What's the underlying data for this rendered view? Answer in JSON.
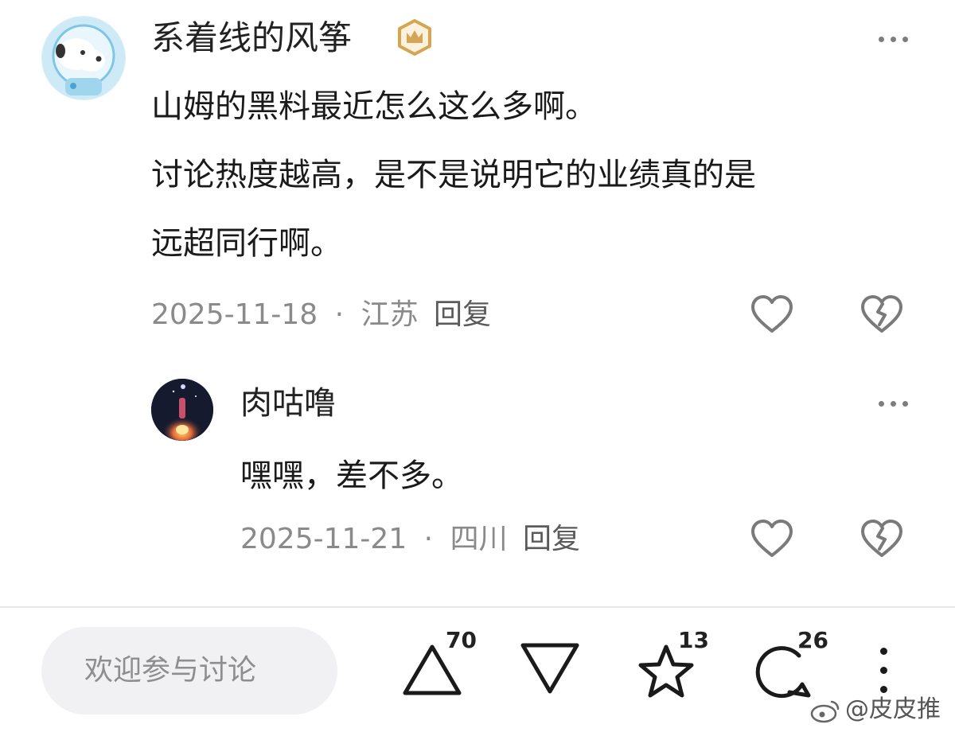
{
  "comment": {
    "username": "系着线的风筝",
    "badge_icon": "crown-badge-icon",
    "text_lines": [
      "山姆的黑料最近怎么这么多啊。",
      "讨论热度越高，是不是说明它的业绩真的是",
      "远超同行啊。"
    ],
    "date": "2025-11-18",
    "separator": "·",
    "location": "江苏",
    "reply_label": "回复"
  },
  "reply": {
    "username": "肉咕噜",
    "text": "嘿嘿，差不多。",
    "date": "2025-11-21",
    "separator": "·",
    "location": "四川",
    "reply_label": "回复"
  },
  "bottom_bar": {
    "input_placeholder": "欢迎参与讨论",
    "upvote_count": "70",
    "favorite_count": "13",
    "comment_count": "26"
  },
  "watermark": {
    "text": "@皮皮推",
    "icon": "weibo-logo-icon"
  },
  "colors": {
    "text_primary": "#1a1a1a",
    "text_meta": "#8a8a8a",
    "icon_gray": "#7a7a7a",
    "badge_gold": "#d4a552",
    "input_bg": "#f1f1f3"
  }
}
